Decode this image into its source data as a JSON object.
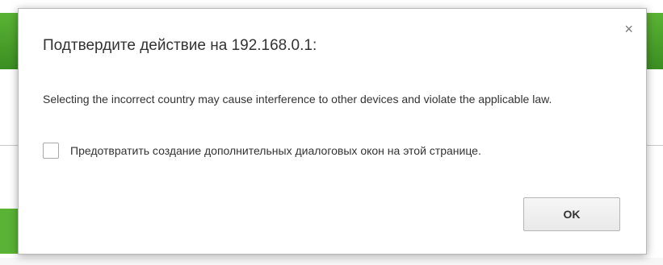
{
  "dialog": {
    "title": "Подтвердите действие на 192.168.0.1:",
    "close_icon": "close-icon",
    "close_glyph": "×",
    "message": "Selecting the incorrect country may cause interference to other devices and violate the applicable law.",
    "suppress_checkbox_label": "Предотвратить создание дополнительных диалоговых окон на этой странице.",
    "suppress_checked": false,
    "ok_label": "OK"
  },
  "colors": {
    "background_header_green": "#4ba32c",
    "dialog_border": "#b9b9b9",
    "text": "#333333"
  }
}
